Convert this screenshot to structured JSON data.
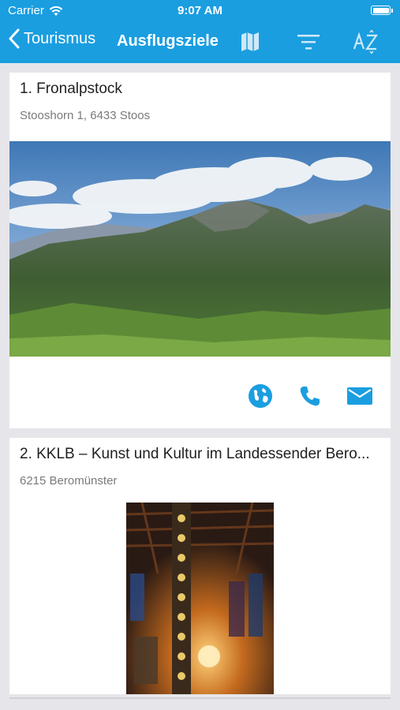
{
  "status_bar": {
    "carrier": "Carrier",
    "time": "9:07 AM"
  },
  "nav": {
    "back_label": "Tourismus",
    "title": "Ausflugsziele",
    "icons": [
      "map-icon",
      "filter-icon",
      "sort-az-icon"
    ]
  },
  "colors": {
    "accent": "#1a9ee0",
    "background": "#e6e6ea",
    "card": "#ffffff",
    "secondary_text": "#7a7a7a"
  },
  "items": [
    {
      "title": "1. Fronalpstock",
      "address": "Stooshorn 1, 6433 Stoos",
      "actions": [
        "globe-icon",
        "phone-icon",
        "mail-icon"
      ]
    },
    {
      "title": "2. KKLB – Kunst und Kultur im Landessender Bero...",
      "address": "6215 Beromünster"
    }
  ]
}
